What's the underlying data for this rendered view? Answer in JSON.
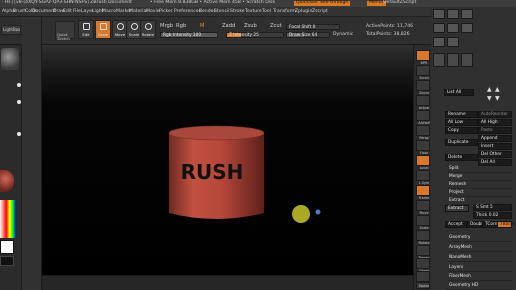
{
  "title_bar": {
    "left_text": "· HF] [v8-(4XQY-SGP2-QP3-SHN-NSFS] ZBrush Document",
    "mem_text": "• Free Mem 8.838GB • Active Mem 458 • Scratch Disk",
    "quicksave": "QuickSave",
    "seethrough": "See-through",
    "menus": "Menus",
    "script": "DefaultZScript"
  },
  "menu_bar": {
    "items": [
      "Alpha",
      "Brush",
      "Color",
      "Document",
      "Draw",
      "Edit",
      "File",
      "Layer",
      "Light",
      "Macro",
      "Marker",
      "Material",
      "Movie",
      "Picker",
      "Preferences",
      "Render",
      "Stencil",
      "Stroke",
      "Texture",
      "Tool",
      "Transform",
      "Zplugin",
      "Zscript"
    ]
  },
  "left_panel": {
    "lightbox_label": "LightBox",
    "quicksketch_label": "Quick Sketch"
  },
  "toolbar": {
    "edit_label": "Edit",
    "draw_label": "Draw",
    "move_label": "Move",
    "scale_label": "Scale",
    "rotate_label": "Rotate",
    "mrgb_label": "Mrgb",
    "rgb_label": "Rgb",
    "m_label": "M",
    "zadd_label": "Zadd",
    "zsub_label": "Zsub",
    "zcut_label": "Zcut",
    "rgb_intensity": "Rgb Intensity 100",
    "z_intensity": "Z Intensity 25",
    "focal_shift": "Focal Shift 0",
    "draw_size": "Draw Size 64",
    "dynamic": "Dynamic",
    "active_points": "ActivePoints: 11,746",
    "total_points": "TotalPoints: 38,826"
  },
  "canvas": {
    "text_on_model": "RUSH",
    "model_color": "#b8493a",
    "cursor_color": "#c8c62a"
  },
  "right_column": {
    "items": [
      "BPR",
      "Scroll",
      "Zoom",
      "Actual",
      "AAHalf",
      "Persp",
      "Floor",
      "Local",
      "L.Sym",
      "Frame",
      "Move",
      "Scale",
      "Rotate",
      "Transp",
      "Ghost",
      "Solo",
      "Xpose"
    ]
  },
  "subtool_panel": {
    "list_all": "List All",
    "rename": "Rename",
    "autoreorder": "AutoReorder",
    "all_low": "All Low",
    "all_high": "All High",
    "copy": "Copy",
    "paste": "Paste",
    "append": "Append",
    "duplicate": "Duplicate",
    "insert": "Insert",
    "delete": "Delete",
    "del_other": "Del Other",
    "del_all": "Del All",
    "split": "Split",
    "merge": "Merge",
    "remesh": "Remesh",
    "project": "Project",
    "extract_header": "Extract",
    "extract_button": "Extract",
    "s_smt": "S Smt 5",
    "thick": "Thick 0.02",
    "accept": "Accept",
    "double": "Double",
    "tcorne": "TCorne",
    "tborder": "TBorde"
  },
  "tool_sections": [
    "Geometry",
    "ArrayMesh",
    "NanoMesh",
    "Layers",
    "FiberMesh",
    "Geometry HD"
  ]
}
